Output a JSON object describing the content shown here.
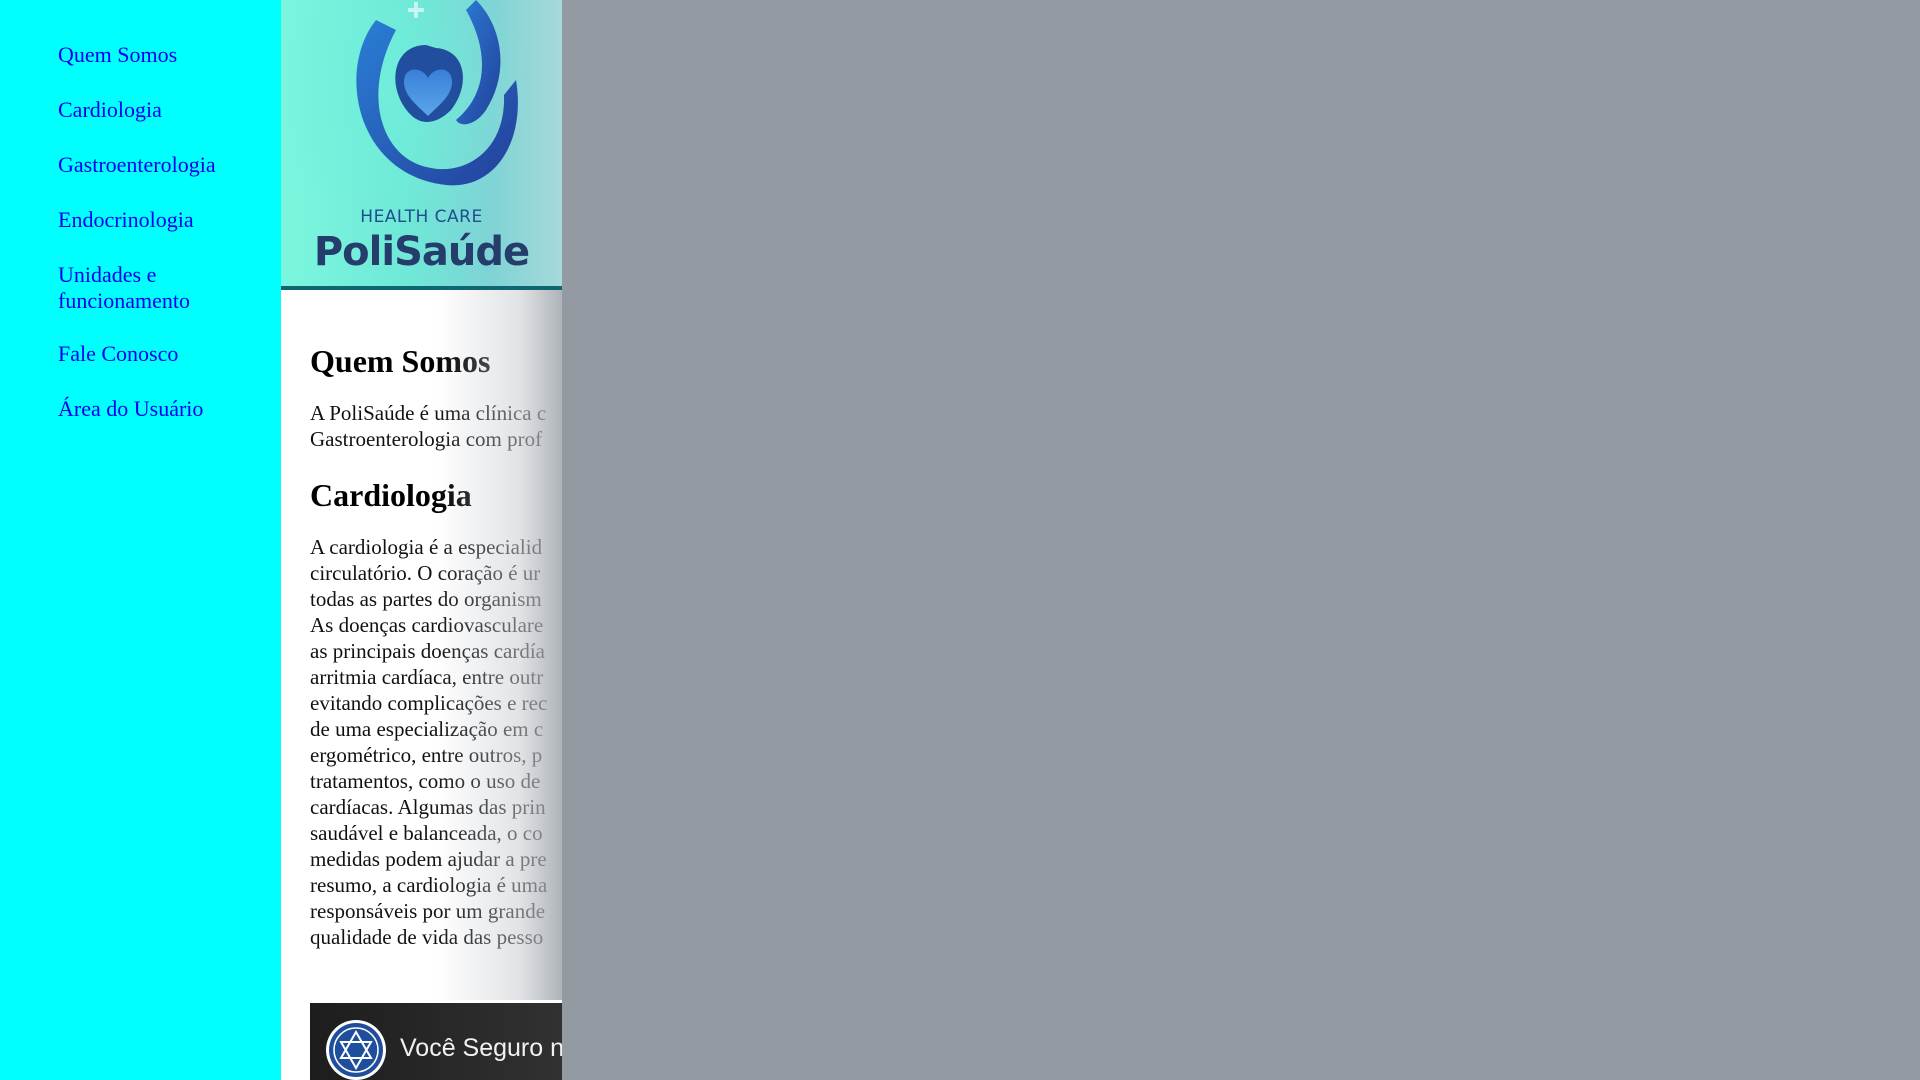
{
  "sidebar": {
    "items": [
      {
        "label": "Quem Somos"
      },
      {
        "label": "Cardiologia"
      },
      {
        "label": "Gastroenterologia"
      },
      {
        "label": "Endocrinologia"
      },
      {
        "label": "Unidades e funcionamento",
        "line1": "Unidades e",
        "line2": "funcionamento"
      },
      {
        "label": "Fale Conosco"
      },
      {
        "label": "Área do Usuário"
      }
    ]
  },
  "header": {
    "logo_tagline": "HEALTH CARE",
    "logo_name": "PoliSaúde"
  },
  "main": {
    "sections": [
      {
        "title": "Quem Somos",
        "lines": [
          "A PoliSaúde é uma clínica c",
          "Gastroenterologia com prof"
        ]
      },
      {
        "title": "Cardiologia",
        "lines": [
          "A cardiologia é a especialid",
          "circulatório. O coração é ur",
          "todas as partes do organism",
          "As doenças cardiovasculare",
          "as principais doenças cardía",
          "arritmia cardíaca, entre outr",
          "evitando complicações e rec",
          "de uma especialização em c",
          "ergométrico, entre outros, p",
          "tratamentos, como o uso de",
          "cardíacas. Algumas das prin",
          "saudável e balanceada, o co",
          "medidas podem ajudar a pre",
          "resumo, a cardiologia é uma",
          "responsáveis por um grande",
          "qualidade de vida das pesso"
        ]
      }
    ],
    "video": {
      "title": "Você Seguro n"
    }
  },
  "colors": {
    "sidebar_bg": "#00ffff",
    "link": "#0000ee",
    "backdrop": "#949aa1",
    "header_rule": "#0f6570"
  },
  "icons": {
    "logo": "heart-in-hands-logo",
    "video_channel": "star-of-david-icon"
  }
}
